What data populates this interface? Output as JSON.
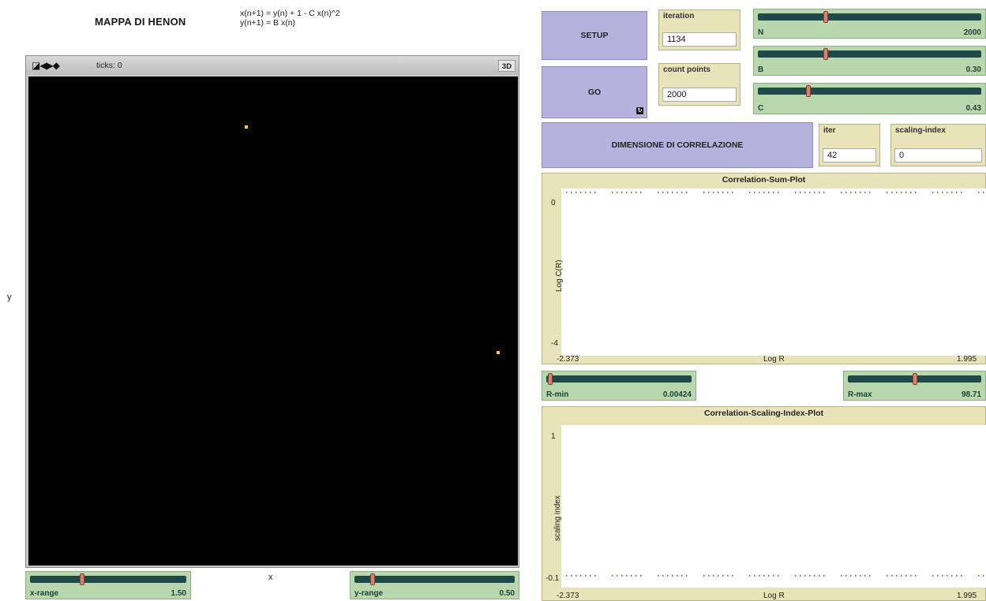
{
  "header": {
    "title": "MAPPA DI HENON",
    "formula": "x(n+1) = y(n) + 1 - C x(n)^2\ny(n+1) = B x(n)"
  },
  "view": {
    "ticks_label": "ticks: 0",
    "three_d_label": "3D",
    "controls_glyphs": "◪◀▶◆",
    "x_axis_label": "x",
    "y_axis_label": "y"
  },
  "controls": {
    "setup_label": "SETUP",
    "go_label": "GO",
    "go_forever_glyph": "↻",
    "dim_label": "DIMENSIONE DI CORRELAZIONE"
  },
  "monitors": {
    "iteration": {
      "label": "iteration",
      "value": "1134"
    },
    "count_points": {
      "label": "count points",
      "value": "2000"
    },
    "iter": {
      "label": "iter",
      "value": "42"
    },
    "scaling_index": {
      "label": "scaling-index",
      "value": "0"
    }
  },
  "sliders": {
    "N": {
      "label": "N",
      "value": "2000",
      "position": 0.3
    },
    "B": {
      "label": "B",
      "value": "0.30",
      "position": 0.3
    },
    "C": {
      "label": "C",
      "value": "0.43",
      "position": 0.22
    },
    "x_range": {
      "label": "x-range",
      "value": "1.50",
      "position": 0.33
    },
    "y_range": {
      "label": "y-range",
      "value": "0.50",
      "position": 0.1
    },
    "r_min": {
      "label": "R-min",
      "value": "0.00424",
      "position": 0.01
    },
    "r_max": {
      "label": "R-max",
      "value": "98.71",
      "position": 0.5
    }
  },
  "plots": {
    "sum": {
      "title": "Correlation-Sum-Plot",
      "xlabel": "Log R",
      "ylabel": "Log C(R)",
      "xmin": "-2.373",
      "xmax": "1.995",
      "ymax": "0",
      "ymin": "-4"
    },
    "scaling": {
      "title": "Correlation-Scaling-Index-Plot",
      "xlabel": "Log R",
      "ylabel": "scaling index",
      "xmin": "-2.373",
      "xmax": "1.995",
      "ymax": "1",
      "ymin": "-0.1"
    }
  },
  "colors": {
    "turtle": "#ffd21f",
    "button": "#b5b3dd",
    "slider": "#b8d7ad",
    "monitor": "#e8e3b8",
    "world": "#000000"
  }
}
